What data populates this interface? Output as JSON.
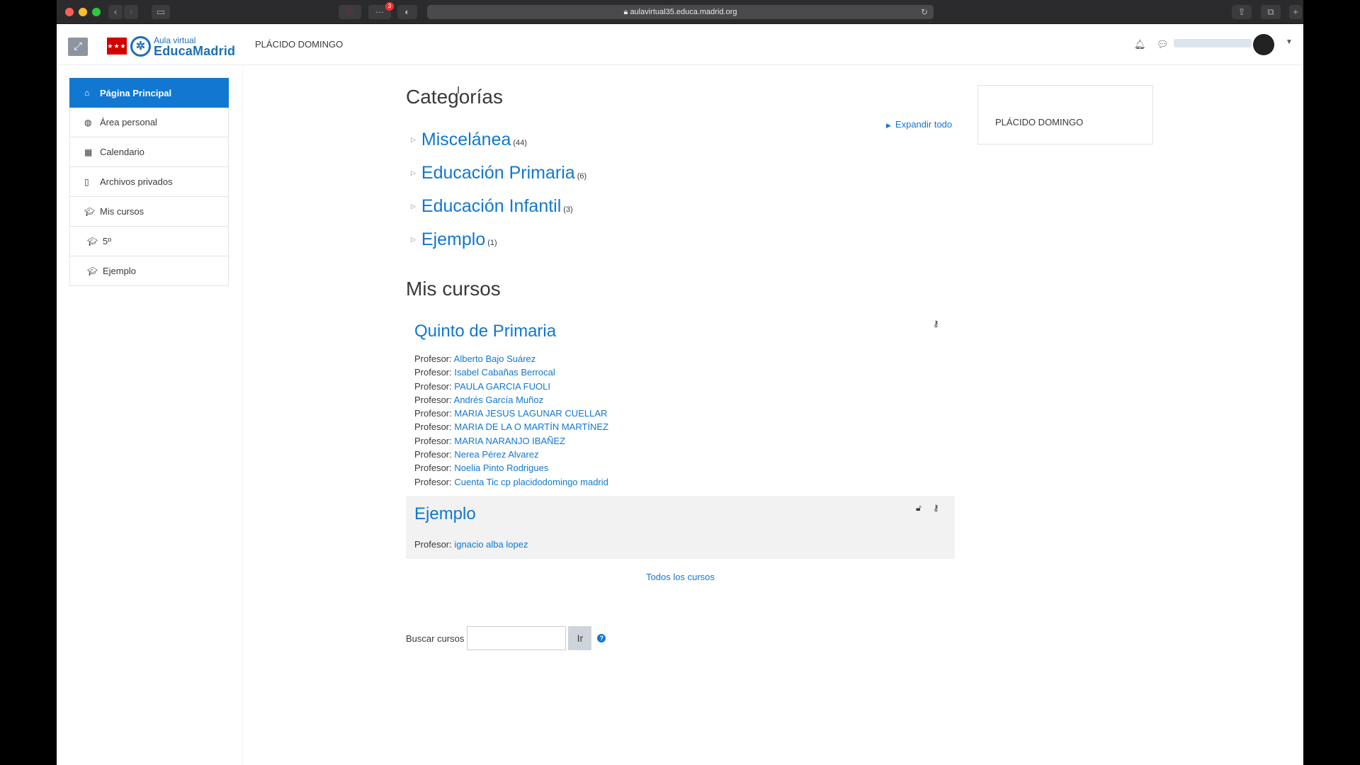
{
  "browser": {
    "url": "aulavirtual35.educa.madrid.org",
    "tab_badge": "3"
  },
  "navbar": {
    "logo_line1": "Aula virtual",
    "logo_line2": "EducaMadrid",
    "site_name": "PLÁCIDO DOMINGO"
  },
  "sidebar": {
    "items": [
      {
        "label": "Página Principal",
        "icon": "home-icon"
      },
      {
        "label": "Área personal",
        "icon": "dashboard-icon"
      },
      {
        "label": "Calendario",
        "icon": "calendar-icon"
      },
      {
        "label": "Archivos privados",
        "icon": "file-icon"
      },
      {
        "label": "Mis cursos",
        "icon": "graduation-cap-icon"
      },
      {
        "label": "5º",
        "icon": "graduation-cap-icon"
      },
      {
        "label": "Ejemplo",
        "icon": "graduation-cap-icon"
      }
    ]
  },
  "main": {
    "categories_title": "Categorías",
    "expand_all": "Expandir todo",
    "categories": [
      {
        "name": "Miscelánea",
        "count": "(44)"
      },
      {
        "name": "Educación Primaria",
        "count": "(6)"
      },
      {
        "name": "Educación Infantil",
        "count": "(3)"
      },
      {
        "name": "Ejemplo",
        "count": "(1)"
      }
    ],
    "my_courses_title": "Mis cursos",
    "courses": [
      {
        "title": "Quinto de Primaria",
        "teacher_label": "Profesor:",
        "teachers": [
          "Alberto Bajo Suárez",
          "Isabel Cabañas Berrocal",
          "PAULA GARCIA FUOLI",
          "Andrés García Muñoz",
          "MARIA JESUS LAGUNAR CUELLAR",
          "MARIA DE LA O MARTÍN MARTÍNEZ",
          "MARIA NARANJO IBAÑEZ",
          "Nerea Pérez Alvarez",
          "Noelia Pinto Rodrigues",
          "Cuenta Tic cp placidodomingo madrid"
        ]
      },
      {
        "title": "Ejemplo",
        "teacher_label": "Profesor:",
        "teachers": [
          "ignacio alba lopez"
        ]
      }
    ],
    "all_courses": "Todos los cursos",
    "search_label": "Buscar cursos",
    "search_value": "",
    "search_button": "Ir"
  },
  "right_block": {
    "text": "PLÁCIDO DOMINGO"
  }
}
